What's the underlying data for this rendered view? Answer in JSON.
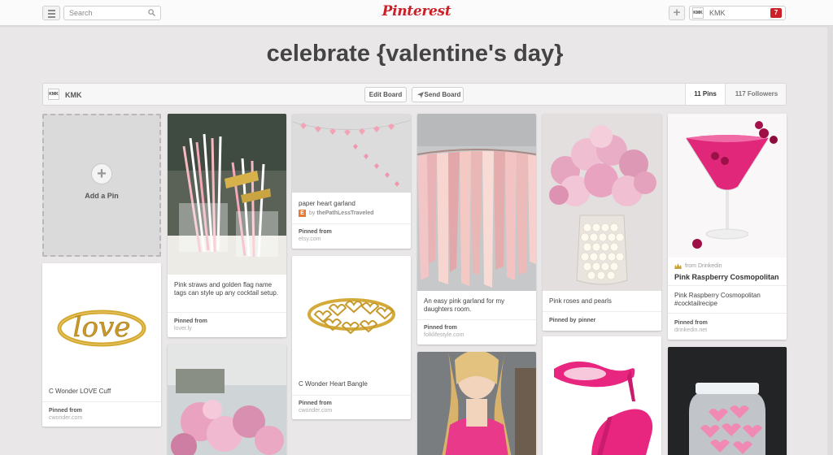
{
  "topbar": {
    "search_placeholder": "Search",
    "logo": "Pinterest",
    "user": {
      "avatar_text": "KMK",
      "name": "KMK",
      "notifications": "7"
    }
  },
  "board": {
    "title": "celebrate {valentine's day}",
    "owner_avatar": "KMK",
    "owner": "KMK",
    "edit_label": "Edit Board",
    "send_label": "Send Board",
    "pins_count": "11 Pins",
    "followers_count": "117 Followers"
  },
  "add_pin": {
    "label": "Add a Pin"
  },
  "pins": [
    {
      "description": "C Wonder LOVE Cuff",
      "source_label": "Pinned from",
      "source": "cwonder.com",
      "image": "gold love cuff bracelet"
    },
    {
      "description": "Pink straws and golden flag name tags can style up any cocktail setup.",
      "source_label": "Pinned from",
      "source": "lover.ly",
      "image": "pink straws"
    },
    {
      "description": "",
      "image": "pink peonies bouquet"
    },
    {
      "description": "paper heart garland",
      "by_prefix": "by",
      "by": "thePathLessTraveled",
      "source_label": "Pinned from",
      "source": "etsy.com",
      "image": "paper heart garland"
    },
    {
      "description": "C Wonder Heart Bangle",
      "source_label": "Pinned from",
      "source": "cwonder.com",
      "image": "gold heart bangle"
    },
    {
      "description": "An easy pink garland for my daughters room.",
      "source_label": "Pinned from",
      "source": "folklifestyle.com",
      "image": "pink fabric garland"
    },
    {
      "description": "",
      "image": "woman in pink dress"
    },
    {
      "description": "Pink roses and pearls",
      "source_label": "Pinned by",
      "source": "pinner",
      "image": "pink roses and pearls"
    },
    {
      "description": "",
      "image": "pink high heels"
    },
    {
      "from_prefix": "from",
      "from": "Drinkedin",
      "title": "Pink Raspberry Cosmopolitan",
      "description": "Pink Raspberry Cosmopolitan #cocktailrecipe",
      "source_label": "Pinned from",
      "source": "drinkedin.net",
      "image": "pink raspberry cocktail"
    },
    {
      "description": "",
      "image": "pink candy jar"
    }
  ],
  "colors": {
    "brand": "#cb2027",
    "background": "#e9e7e7"
  }
}
